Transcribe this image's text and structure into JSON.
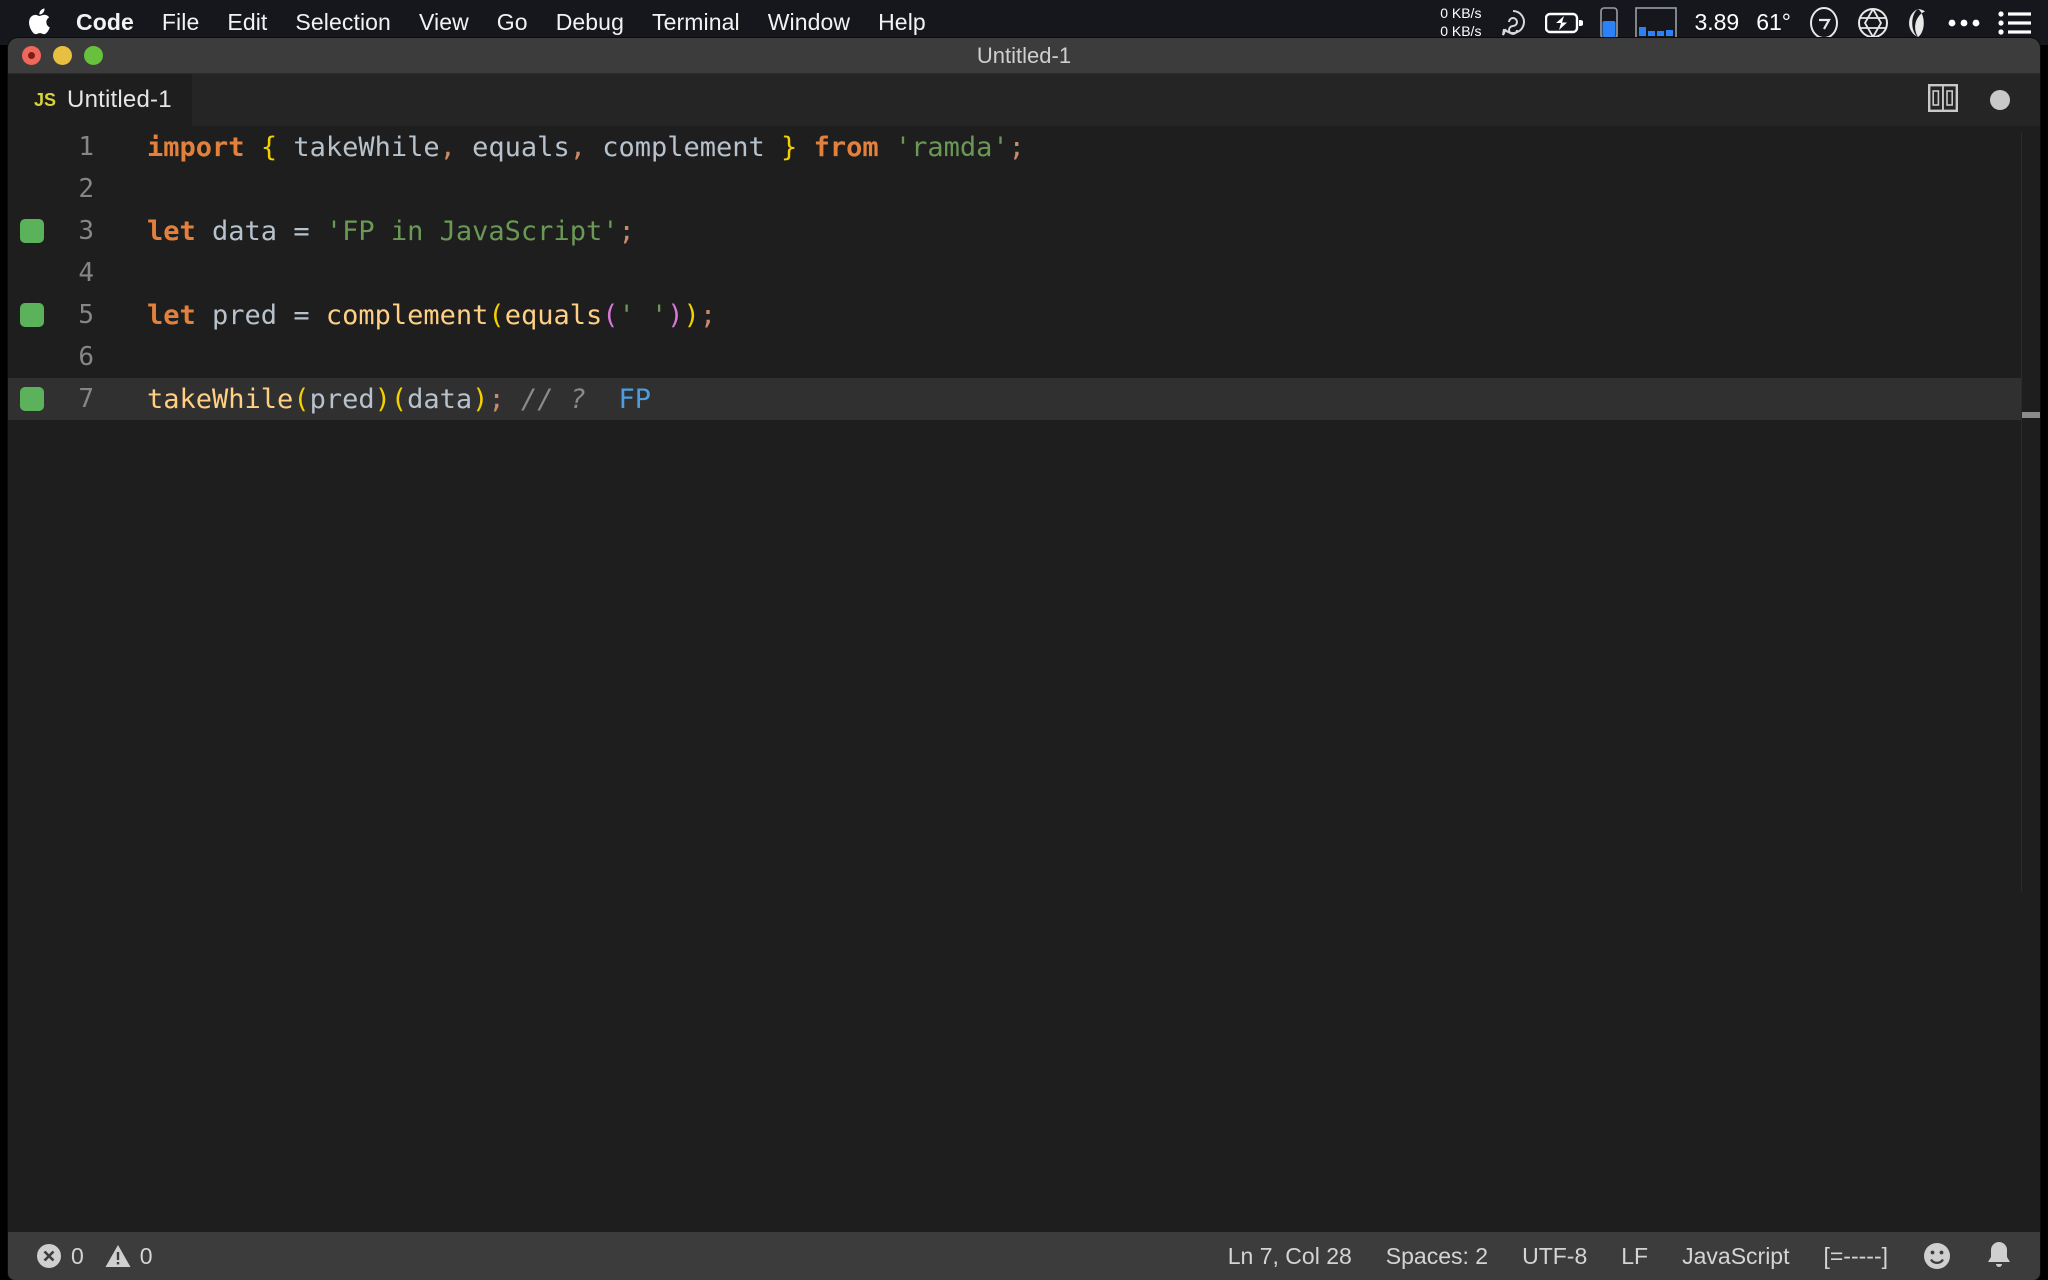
{
  "menubar": {
    "apple_icon": "apple-logo-icon",
    "items": [
      {
        "label": "Code",
        "bold": true
      },
      {
        "label": "File",
        "bold": false
      },
      {
        "label": "Edit",
        "bold": false
      },
      {
        "label": "Selection",
        "bold": false
      },
      {
        "label": "View",
        "bold": false
      },
      {
        "label": "Go",
        "bold": false
      },
      {
        "label": "Debug",
        "bold": false
      },
      {
        "label": "Terminal",
        "bold": false
      },
      {
        "label": "Window",
        "bold": false
      },
      {
        "label": "Help",
        "bold": false
      }
    ],
    "status": {
      "net_up": "0 KB/s",
      "net_down": "0 KB/s",
      "cpu_load": "3.89",
      "temperature": "61°",
      "icons": [
        "network-speed-icon",
        "cloud-sync-icon",
        "battery-charging-icon",
        "battery-level-icon",
        "cpu-histogram-icon",
        "timer-icon",
        "aperture-icon",
        "moon-phase-icon",
        "ellipsis-icon",
        "menu-list-icon"
      ]
    }
  },
  "window": {
    "title": "Untitled-1",
    "traffic_lights": [
      "close-button",
      "minimize-button",
      "maximize-button"
    ]
  },
  "tab": {
    "file_icon": "js-file-icon",
    "file_icon_label": "JS",
    "label": "Untitled-1",
    "split_editor_icon": "split-editor-icon",
    "unsaved_indicator": "unsaved-dot-icon"
  },
  "editor": {
    "lines": [
      {
        "number": "1",
        "marker": false,
        "active": false,
        "tokens": [
          {
            "t": "import",
            "c": "kw"
          },
          {
            "t": " ",
            "c": "plain"
          },
          {
            "t": "{",
            "c": "brace-y"
          },
          {
            "t": " takeWhile",
            "c": "plain"
          },
          {
            "t": ",",
            "c": "punc"
          },
          {
            "t": " equals",
            "c": "plain"
          },
          {
            "t": ",",
            "c": "punc"
          },
          {
            "t": " complement ",
            "c": "plain"
          },
          {
            "t": "}",
            "c": "brace-y"
          },
          {
            "t": " ",
            "c": "plain"
          },
          {
            "t": "from",
            "c": "kw"
          },
          {
            "t": " ",
            "c": "plain"
          },
          {
            "t": "'ramda'",
            "c": "str"
          },
          {
            "t": ";",
            "c": "punc"
          }
        ]
      },
      {
        "number": "2",
        "marker": false,
        "active": false,
        "tokens": []
      },
      {
        "number": "3",
        "marker": true,
        "active": false,
        "tokens": [
          {
            "t": "let",
            "c": "kw"
          },
          {
            "t": " data ",
            "c": "plain"
          },
          {
            "t": "=",
            "c": "op"
          },
          {
            "t": " ",
            "c": "plain"
          },
          {
            "t": "'FP in JavaScript'",
            "c": "str"
          },
          {
            "t": ";",
            "c": "punc"
          }
        ]
      },
      {
        "number": "4",
        "marker": false,
        "active": false,
        "tokens": []
      },
      {
        "number": "5",
        "marker": true,
        "active": false,
        "tokens": [
          {
            "t": "let",
            "c": "kw"
          },
          {
            "t": " pred ",
            "c": "plain"
          },
          {
            "t": "=",
            "c": "op"
          },
          {
            "t": " ",
            "c": "plain"
          },
          {
            "t": "complement",
            "c": "fn"
          },
          {
            "t": "(",
            "c": "brace-y"
          },
          {
            "t": "equals",
            "c": "fn"
          },
          {
            "t": "(",
            "c": "brace-m"
          },
          {
            "t": "' '",
            "c": "str"
          },
          {
            "t": ")",
            "c": "brace-m"
          },
          {
            "t": ")",
            "c": "brace-y"
          },
          {
            "t": ";",
            "c": "punc"
          }
        ]
      },
      {
        "number": "6",
        "marker": false,
        "active": false,
        "tokens": []
      },
      {
        "number": "7",
        "marker": true,
        "active": true,
        "tokens": [
          {
            "t": "takeWhile",
            "c": "fn"
          },
          {
            "t": "(",
            "c": "brace-y"
          },
          {
            "t": "pred",
            "c": "plain"
          },
          {
            "t": ")",
            "c": "brace-y"
          },
          {
            "t": "(",
            "c": "brace-y"
          },
          {
            "t": "data",
            "c": "plain"
          },
          {
            "t": ")",
            "c": "brace-y"
          },
          {
            "t": ";",
            "c": "punc"
          },
          {
            "t": " // ?",
            "c": "comment"
          },
          {
            "t": "  FP",
            "c": "result"
          }
        ]
      }
    ]
  },
  "statusbar": {
    "error_icon": "error-circle-icon",
    "error_count": "0",
    "warning_icon": "warning-triangle-icon",
    "warning_count": "0",
    "cursor_position": "Ln 7, Col 28",
    "indentation": "Spaces: 2",
    "encoding": "UTF-8",
    "eol": "LF",
    "language": "JavaScript",
    "progress": "[=-----]",
    "feedback_icon": "smiley-icon",
    "notifications_icon": "bell-icon"
  },
  "colors": {
    "editor_bg": "#1e1e1e",
    "tabbar_bg": "#252526",
    "titlebar_bg": "#3c3c3c",
    "statusbar_bg": "#3c3c3c",
    "marker_green": "#5bb25b",
    "keyword_orange": "#e2803c",
    "string_green": "#6a9955",
    "function_yellow": "#ffd083",
    "bracket_yellow": "#f3d000",
    "bracket_magenta": "#d977d9",
    "result_blue": "#4d9de0"
  }
}
